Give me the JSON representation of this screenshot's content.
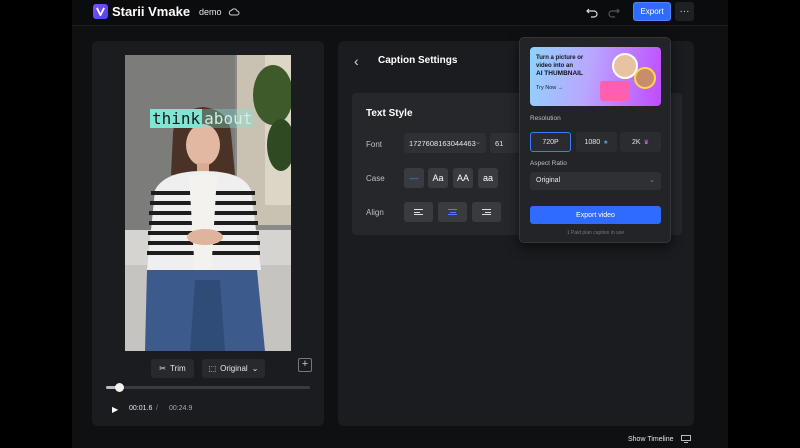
{
  "app": {
    "name": "Starii Vmake",
    "project": "demo",
    "export_label": "Export",
    "more_label": "···"
  },
  "preview": {
    "caption_word_active": "think",
    "caption_word_next": "about",
    "trim_label": "Trim",
    "ratio_label": "Original",
    "current_time": "00:01.6",
    "separator": "/",
    "total_time": "00:24.9",
    "progress": 0.064
  },
  "caption_settings": {
    "title": "Caption Settings",
    "text_style_title": "Text Style",
    "font_label": "Font",
    "font_value": "1727608163044463",
    "size_value": "61",
    "case_label": "Case",
    "case_options": [
      "—",
      "Aa",
      "AA",
      "aa"
    ],
    "case_selected": 0,
    "align_label": "Align",
    "align_selected": 1
  },
  "export_popup": {
    "promo_line1": "Turn a picture or",
    "promo_line2": "video into an",
    "promo_highlight": "AI THUMBNAIL",
    "promo_try": "Try Now →",
    "resolution_label": "Resolution",
    "resolutions": [
      {
        "label": "720P",
        "badge": ""
      },
      {
        "label": "1080",
        "badge": "★"
      },
      {
        "label": "2K",
        "badge": "♛"
      }
    ],
    "resolution_selected": "720P",
    "aspect_ratio_label": "Aspect Ratio",
    "aspect_ratio_value": "Original",
    "export_video_label": "Export video",
    "paid_note": "1 Paid plan caption in use"
  },
  "footer": {
    "show_timeline_label": "Show Timeline"
  },
  "colors": {
    "accent": "#2f6bff",
    "caption_highlight": "#7fe6d4",
    "panel": "#1b1c20"
  }
}
